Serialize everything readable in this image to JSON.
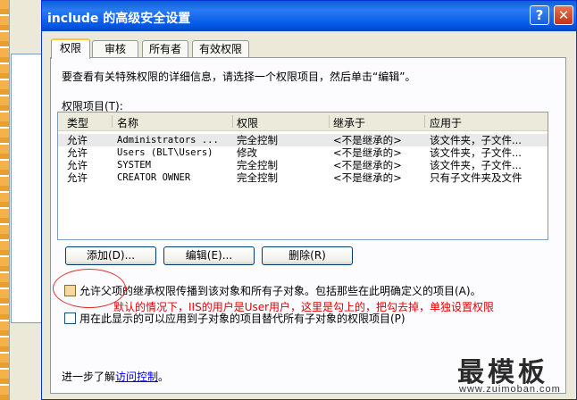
{
  "window": {
    "title": "include 的高级安全设置",
    "help_label": "?",
    "close_label": "✕"
  },
  "tabs": [
    "权限",
    "审核",
    "所有者",
    "有效权限"
  ],
  "intro": "要查看有关特殊权限的详细信息，请选择一个权限项目，然后单击“编辑”。",
  "list_label": "权限项目(T):",
  "columns": [
    "类型",
    "名称",
    "权限",
    "继承于",
    "应用于"
  ],
  "rows": [
    {
      "type": "允许",
      "name": "Administrators ...",
      "perm": "完全控制",
      "inherit": "<不是继承的>",
      "apply": "该文件夹，子文件..."
    },
    {
      "type": "允许",
      "name": "Users (BLT\\Users)",
      "perm": "修改",
      "inherit": "<不是继承的>",
      "apply": "该文件夹，子文件..."
    },
    {
      "type": "允许",
      "name": "SYSTEM",
      "perm": "完全控制",
      "inherit": "<不是继承的>",
      "apply": "该文件夹，子文件..."
    },
    {
      "type": "允许",
      "name": "CREATOR OWNER",
      "perm": "完全控制",
      "inherit": "<不是继承的>",
      "apply": "只有子文件夹及文件"
    }
  ],
  "buttons": {
    "add": "添加(D)...",
    "edit": "编辑(E)...",
    "remove": "删除(R)"
  },
  "checkbox_inherit": "允许父项的继承权限传播到该对象和所有子对象。包括那些在此明确定义的项目(A)。",
  "annotation": "默认的情况下，IIS的用户是User用户，这里是勾上的，把勾去掉，单独设置权限",
  "checkbox_replace": "用在此显示的可以应用到子对象的项目替代所有子对象的权限项目(P)",
  "footer": {
    "prefix": "进一步了解",
    "link": "访问控制",
    "suffix": "。"
  },
  "watermark": {
    "title": "最模板",
    "url": "www.zuimoban.com"
  },
  "colors": {
    "titlebar": "#0058e6",
    "annotation": "#e00000",
    "link": "#0000ee",
    "selected_tab_accent": "#ffc83c"
  }
}
